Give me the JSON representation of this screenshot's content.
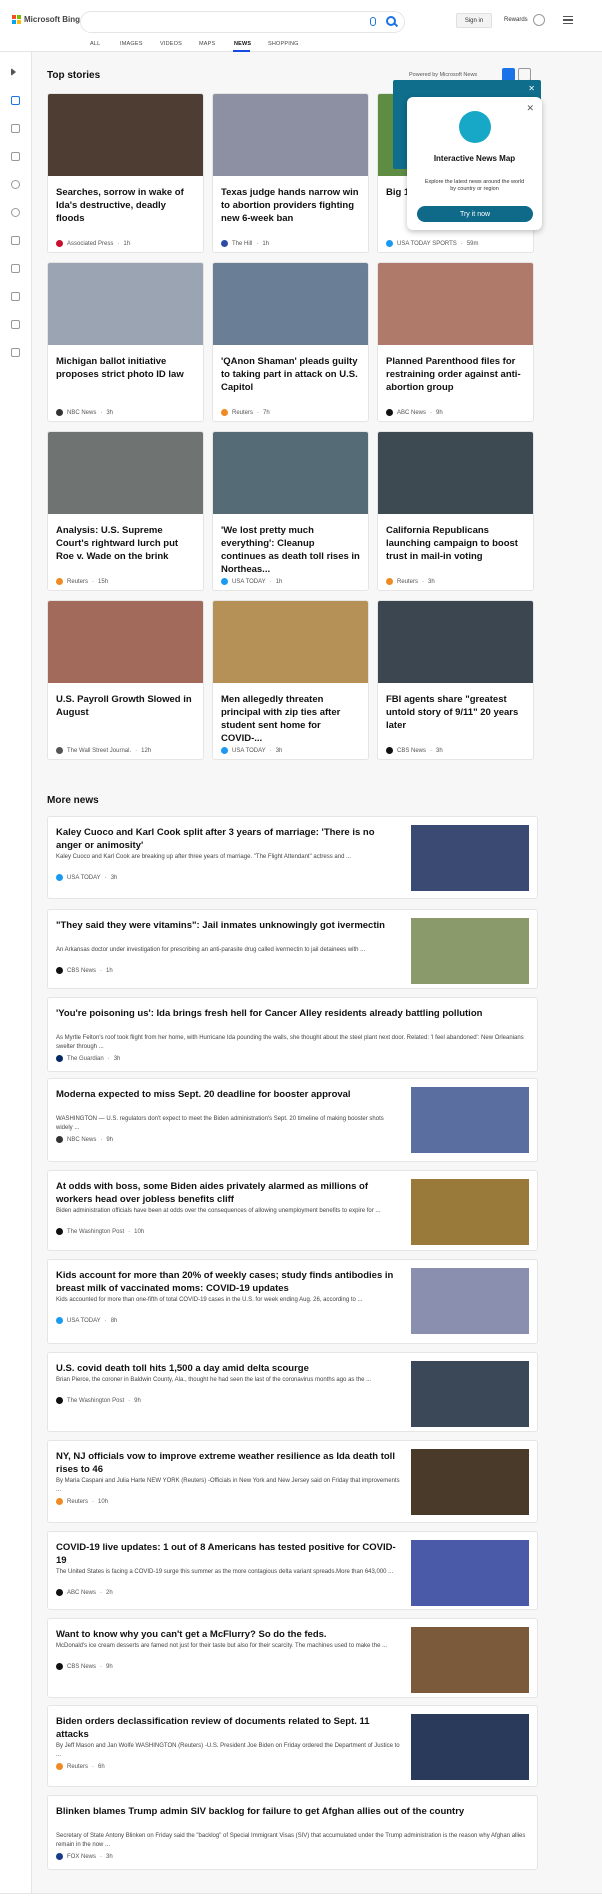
{
  "header": {
    "logo_text": "Microsoft Bing",
    "signin_label": "Sign in",
    "rewards_label": "Rewards"
  },
  "nav": [
    "ALL",
    "IMAGES",
    "VIDEOS",
    "MAPS",
    "NEWS",
    "SHOPPING"
  ],
  "top_stories": {
    "title": "Top stories",
    "powered_by": "Powered by Microsoft News",
    "cards": [
      {
        "title": "Searches, sorrow in wake of Ida's destructive, deadly floods",
        "source": "Associated Press",
        "age": "1h",
        "img_color": "#4e3d33",
        "src_color": "#c8102e"
      },
      {
        "title": "Texas judge hands narrow win to abortion providers fighting new 6-week ban",
        "source": "The Hill",
        "age": "1h",
        "img_color": "#8d8fa3",
        "src_color": "#2c4ba8"
      },
      {
        "title": "Big 12 ... new ... BYU, ...",
        "source": "USA TODAY SPORTS",
        "age": "59m",
        "img_color": "#5e8c42",
        "src_color": "#1a9af0"
      },
      {
        "title": "Michigan ballot initiative proposes strict photo ID law",
        "source": "NBC News",
        "age": "3h",
        "img_color": "#9aa4b3",
        "src_color": "#333"
      },
      {
        "title": "'QAnon Shaman' pleads guilty to taking part in attack on U.S. Capitol",
        "source": "Reuters",
        "age": "7h",
        "img_color": "#6a7f96",
        "src_color": "#f08a24"
      },
      {
        "title": "Planned Parenthood files for restraining order against anti-abortion group",
        "source": "ABC News",
        "age": "9h",
        "img_color": "#b07a6a",
        "src_color": "#111"
      },
      {
        "title": "Analysis: U.S. Supreme Court's rightward lurch put Roe v. Wade on the brink",
        "source": "Reuters",
        "age": "15h",
        "img_color": "#6f7372",
        "src_color": "#f08a24"
      },
      {
        "title": "'We lost pretty much everything': Cleanup continues as death toll rises in Northeas...",
        "source": "USA TODAY",
        "age": "1h",
        "img_color": "#556b76",
        "src_color": "#1a9af0"
      },
      {
        "title": "California Republicans launching campaign to boost trust in mail-in voting",
        "source": "Reuters",
        "age": "3h",
        "img_color": "#3e4a52",
        "src_color": "#f08a24"
      },
      {
        "title": "U.S. Payroll Growth Slowed in August",
        "source": "The Wall Street Journal.",
        "age": "12h",
        "img_color": "#a26a5a",
        "src_color": "#555"
      },
      {
        "title": "Men allegedly threaten principal with zip ties after student sent home for COVID-...",
        "source": "USA TODAY",
        "age": "3h",
        "img_color": "#b69157",
        "src_color": "#1a9af0"
      },
      {
        "title": "FBI agents share \"greatest untold story of 9/11\" 20 years later",
        "source": "CBS News",
        "age": "3h",
        "img_color": "#3c4650",
        "src_color": "#111"
      }
    ]
  },
  "popup": {
    "title": "Interactive News Map",
    "text": "Explore the latest news around the world by country or region",
    "button_label": "Try it now"
  },
  "more_news": {
    "title": "More news",
    "items": [
      {
        "title": "Kaley Cuoco and Karl Cook split after 3 years of marriage: 'There is no anger or animosity'",
        "snippet": "Kaley Cuoco and Karl Cook are breaking up after three years of marriage. \"The Flight Attendant\" actress and ...",
        "source": "USA TODAY",
        "age": "3h",
        "img_color": "#3a4a72",
        "src_color": "#1a9af0"
      },
      {
        "title": "\"They said they were vitamins\": Jail inmates unknowingly got ivermectin",
        "snippet": "An Arkansas doctor under investigation for prescribing an anti-parasite drug called ivermectin to jail detainees with ...",
        "source": "CBS News",
        "age": "1h",
        "img_color": "#8a9a6a",
        "src_color": "#111"
      },
      {
        "title": "'You're poisoning us': Ida brings fresh hell for Cancer Alley residents already battling pollution",
        "snippet": "As Myrtle Felton's roof took flight from her home, with Hurricane Ida pounding the walls, she thought about the steel plant next door. Related: 'I feel abandoned': New Orleanians swelter through ...",
        "source": "The Guardian",
        "age": "3h",
        "img_color": "",
        "src_color": "#052962"
      },
      {
        "title": "Moderna expected to miss Sept. 20 deadline for booster approval",
        "snippet": "WASHINGTON — U.S. regulators don't expect to meet the Biden administration's Sept. 20 timeline of making booster shots widely ...",
        "source": "NBC News",
        "age": "9h",
        "img_color": "#5a6fa0",
        "src_color": "#333"
      },
      {
        "title": "At odds with boss, some Biden aides privately alarmed as millions of workers head over jobless benefits cliff",
        "snippet": "Biden administration officials have been at odds over the consequences of allowing unemployment benefits to expire for ...",
        "source": "The Washington Post",
        "age": "10h",
        "img_color": "#9a7a3a",
        "src_color": "#111"
      },
      {
        "title": "Kids account for more than 20% of weekly cases; study finds antibodies in breast milk of vaccinated moms: COVID-19 updates",
        "snippet": "Kids accounted for more than one-fifth of total COVID-19 cases in the U.S. for week ending Aug. 26, according to ...",
        "source": "USA TODAY",
        "age": "8h",
        "img_color": "#8a8fb0",
        "src_color": "#1a9af0"
      },
      {
        "title": "U.S. covid death toll hits 1,500 a day amid delta scourge",
        "snippet": "Brian Pierce, the coroner in Baldwin County, Ala., thought he had seen the last of the coronavirus months ago as the ...",
        "source": "The Washington Post",
        "age": "9h",
        "img_color": "#3a4858",
        "src_color": "#111"
      },
      {
        "title": "NY, NJ officials vow to improve extreme weather resilience as Ida death toll rises to 46",
        "snippet": "By Maria Caspani and Julia Harte NEW YORK (Reuters) -Officials in New York and New Jersey said on Friday that improvements ...",
        "source": "Reuters",
        "age": "10h",
        "img_color": "#4a3a2a",
        "src_color": "#f08a24"
      },
      {
        "title": "COVID-19 live updates: 1 out of 8 Americans has tested positive for COVID-19",
        "snippet": "The United States is facing a COVID-19 surge this summer as the more contagious delta variant spreads.More than 643,000 ...",
        "source": "ABC News",
        "age": "2h",
        "img_color": "#4a5aa8",
        "src_color": "#111"
      },
      {
        "title": "Want to know why you can't get a McFlurry? So do the feds.",
        "snippet": "McDonald's ice cream desserts are famed not just for their taste but also for their scarcity. The machines used to make the ...",
        "source": "CBS News",
        "age": "9h",
        "img_color": "#7a5a3a",
        "src_color": "#111"
      },
      {
        "title": "Biden orders declassification review of documents related to Sept. 11 attacks",
        "snippet": "By Jeff Mason and Jan Wolfe WASHINGTON (Reuters) -U.S. President Joe Biden on Friday ordered the Department of Justice to ...",
        "source": "Reuters",
        "age": "6h",
        "img_color": "#2a3a5a",
        "src_color": "#f08a24"
      },
      {
        "title": "Blinken blames Trump admin SIV backlog for failure to get Afghan allies out of the country",
        "snippet": "Secretary of State Antony Blinken on Friday said the \"backlog\" of Special Immigrant Visas (SIV) that accumulated under the Trump administration is the reason why Afghan allies remain in the now ...",
        "source": "FOX News",
        "age": "3h",
        "img_color": "",
        "src_color": "#1a3a8a"
      }
    ]
  }
}
